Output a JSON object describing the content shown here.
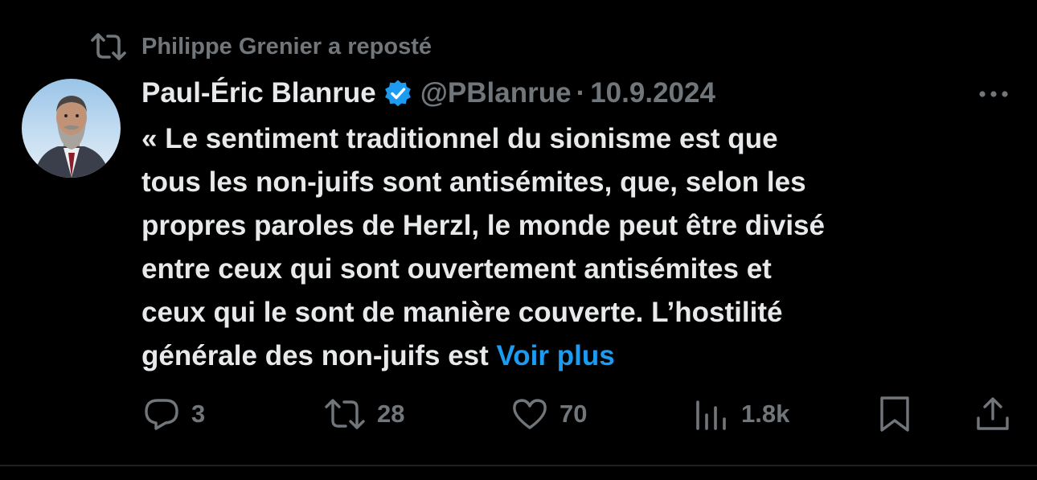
{
  "repost": {
    "text": "Philippe Grenier a reposté",
    "icon": "repost-icon"
  },
  "author": {
    "display_name": "Paul-Éric Blanrue",
    "handle": "@PBlanrue",
    "separator": "·",
    "date": "10.9.2024",
    "verified_icon": "verified-badge-icon",
    "avatar_icon": "avatar"
  },
  "more_icon": "more-options-icon",
  "body": {
    "lines": [
      "« Le sentiment traditionnel du sionisme est que",
      "tous les non-juifs sont antisémites, que, selon les",
      "propres paroles de Herzl, le monde peut être divisé",
      "entre ceux qui sont ouvertement antisémites et",
      "ceux qui le sont de manière couverte. L’hostilité",
      "générale des non-juifs est"
    ],
    "see_more": "Voir plus"
  },
  "actions": {
    "reply": {
      "icon": "reply-icon",
      "count": "3"
    },
    "repost": {
      "icon": "repost-icon",
      "count": "28"
    },
    "like": {
      "icon": "heart-icon",
      "count": "70"
    },
    "views": {
      "icon": "views-icon",
      "count": "1.8k"
    },
    "bookmark": {
      "icon": "bookmark-icon"
    },
    "share": {
      "icon": "share-icon"
    }
  },
  "colors": {
    "background": "#000000",
    "primary_text": "#e7e9ea",
    "secondary_text": "#71767b",
    "link": "#1d9bf0",
    "verified": "#1d9bf0"
  }
}
